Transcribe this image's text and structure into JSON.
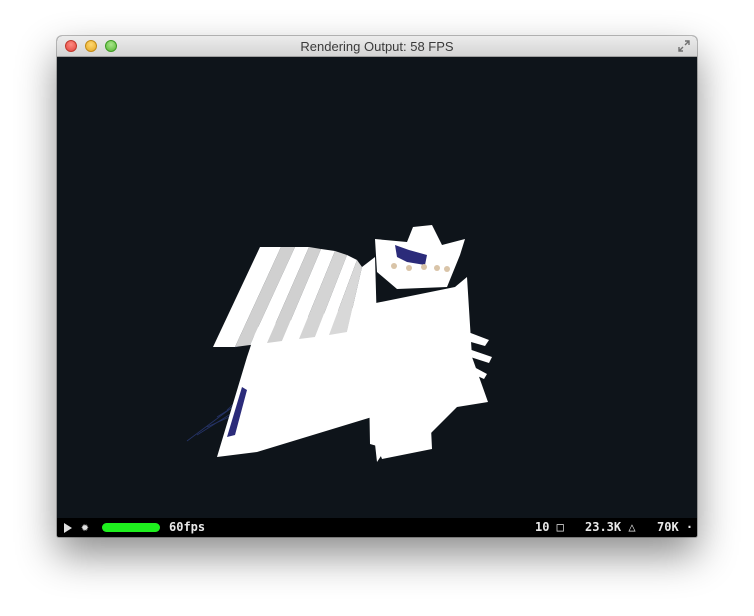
{
  "window": {
    "title": "Rendering Output: 58 FPS"
  },
  "status_bar": {
    "fps_label": "60fps",
    "fps_level": 1.0,
    "fps_bar_color": "#1ef01e",
    "draw_calls": "10 □",
    "triangles": "23.3K △",
    "vertices": "70K ·",
    "icons": [
      "play-icon",
      "gear-icon"
    ]
  },
  "colors": {
    "viewport_background": "#0e141a",
    "model_primary": "#ffffff",
    "model_accent": "#2b2b7a",
    "model_detail": "#d9c4a8"
  }
}
